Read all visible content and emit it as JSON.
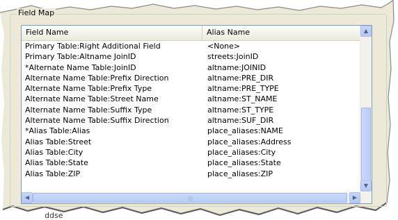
{
  "group": {
    "label": "Field Map"
  },
  "table": {
    "headers": {
      "field": "Field Name",
      "alias": "Alias Name"
    },
    "rows": [
      {
        "field": "Primary Table:Right Additional Field",
        "alias": "<None>"
      },
      {
        "field": "Primary Table:Altname JoinID",
        "alias": "streets:JoinID"
      },
      {
        "field": "*Alternate Name Table:JoinID",
        "alias": "altname:JOINID"
      },
      {
        "field": "Alternate Name Table:Prefix Direction",
        "alias": "altname:PRE_DIR"
      },
      {
        "field": "Alternate Name Table:Prefix Type",
        "alias": "altname:PRE_TYPE"
      },
      {
        "field": "Alternate Name Table:Street Name",
        "alias": "altname:ST_NAME"
      },
      {
        "field": "Alternate Name Table:Suffix Type",
        "alias": "altname:ST_TYPE"
      },
      {
        "field": "Alternate Name Table:Suffix Direction",
        "alias": "altname:SUF_DIR"
      },
      {
        "field": "*Alias Table:Alias",
        "alias": "place_aliases:NAME"
      },
      {
        "field": "Alias Table:Street",
        "alias": "place_aliases:Address"
      },
      {
        "field": "Alias Table:City",
        "alias": "place_aliases:City"
      },
      {
        "field": "Alias Table:State",
        "alias": "place_aliases:State"
      },
      {
        "field": "Alias Table:ZIP",
        "alias": "place_aliases:ZIP"
      }
    ]
  },
  "scrollbar": {
    "up_icon": "chevron-up-icon",
    "down_icon": "chevron-down-icon",
    "left_icon": "chevron-left-icon",
    "right_icon": "chevron-right-icon"
  },
  "bottom_label": "ddse"
}
